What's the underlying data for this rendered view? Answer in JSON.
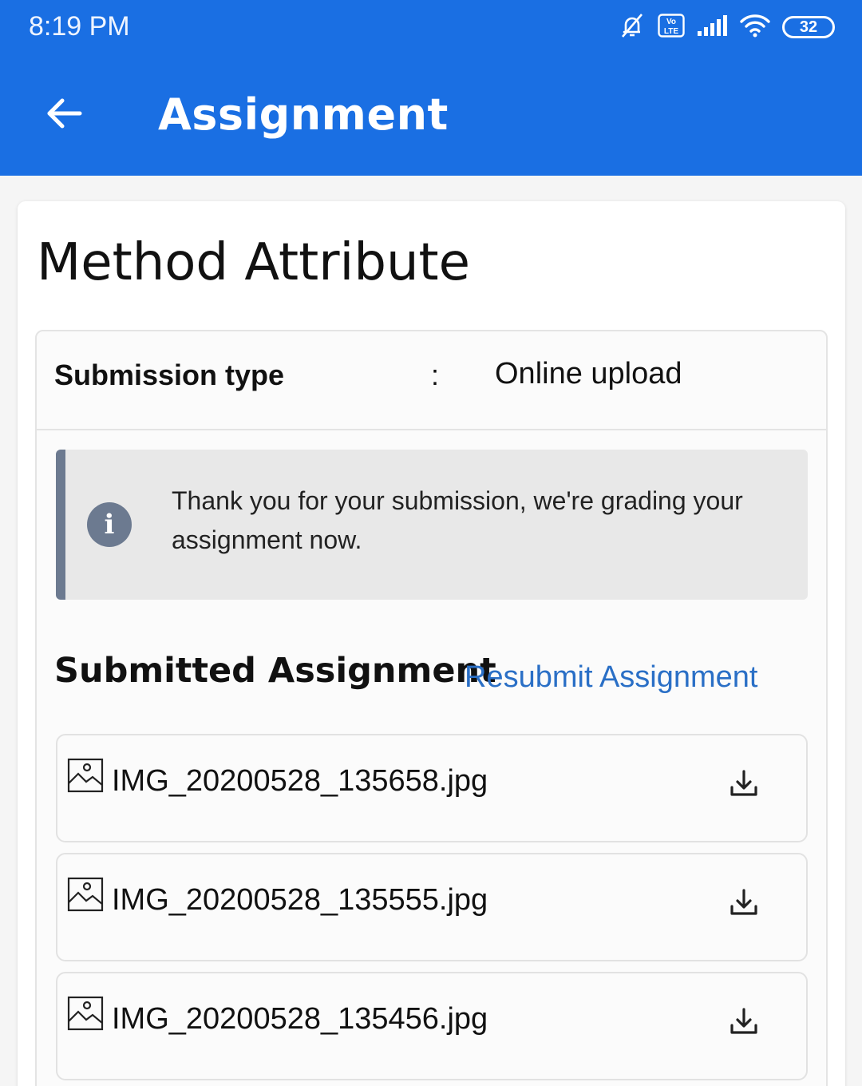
{
  "status_bar": {
    "time": "8:19 PM",
    "battery": "32",
    "volte": "Vo LTE",
    "icons": [
      "mute-icon",
      "volte-icon",
      "signal-icon",
      "wifi-icon",
      "battery-icon"
    ]
  },
  "header": {
    "title": "Assignment",
    "back_icon": "arrow-left-icon",
    "background": "#1a6fe3"
  },
  "card": {
    "title": "Method Attribute"
  },
  "submission": {
    "label": "Submission type",
    "separator": ":",
    "value": "Online upload"
  },
  "alert": {
    "icon": "info-icon",
    "message": "Thank you for your submission, we're grading your assignment now.",
    "accent": "#6c7a90"
  },
  "submitted": {
    "heading": "Submitted Assignment",
    "resubmit_label": "Resubmit Assignment",
    "link_color": "#2a6fc6",
    "files": [
      {
        "name": "IMG_20200528_135658.jpg",
        "icon": "image-icon",
        "action_icon": "download-icon"
      },
      {
        "name": "IMG_20200528_135555.jpg",
        "icon": "image-icon",
        "action_icon": "download-icon"
      },
      {
        "name": "IMG_20200528_135456.jpg",
        "icon": "image-icon",
        "action_icon": "download-icon"
      }
    ]
  }
}
